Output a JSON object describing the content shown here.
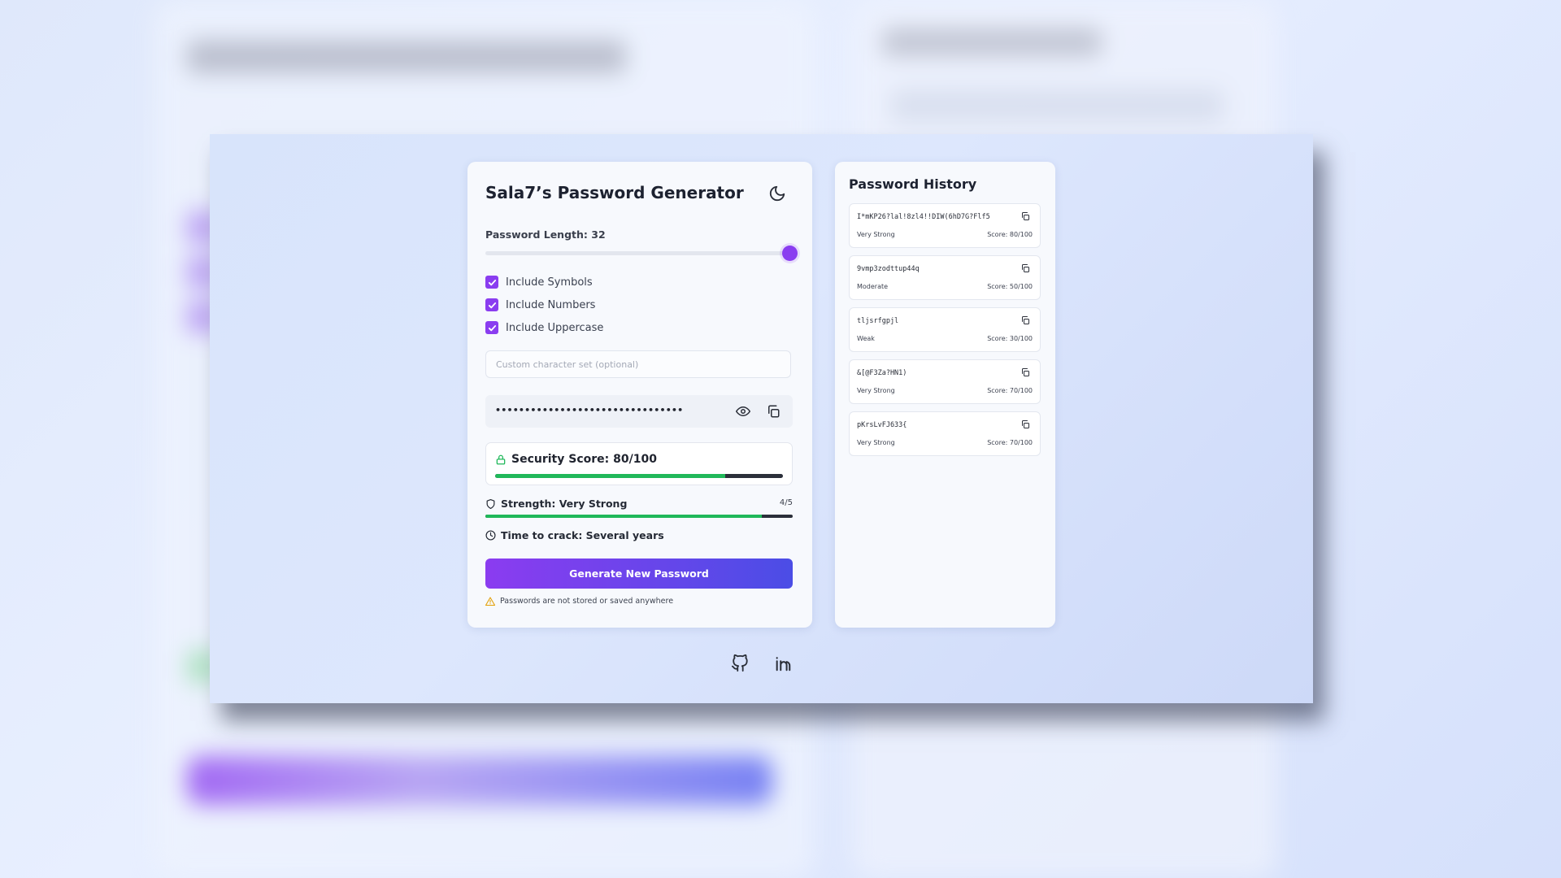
{
  "app": {
    "title": "Sala7’s Password Generator",
    "theme_toggle_icon": "moon-icon"
  },
  "generator": {
    "length_label": "Password Length: 32",
    "length_value": 32,
    "length_max": 32,
    "options": [
      {
        "label": "Include Symbols",
        "checked": true
      },
      {
        "label": "Include Numbers",
        "checked": true
      },
      {
        "label": "Include Uppercase",
        "checked": true
      }
    ],
    "custom_placeholder": "Custom character set (optional)",
    "custom_value": "",
    "password_masked": "••••••••••••••••••••••••••••••••",
    "security_score_label": "Security Score: 80/100",
    "security_score": 80,
    "strength_label": "Strength: Very Strong",
    "strength_ratio": "4/5",
    "strength_level": 0.9,
    "crack_label": "Time to crack: Several years",
    "generate_label": "Generate New Password",
    "note": "Passwords are not stored or saved anywhere",
    "colors": {
      "accent": "#8a3df0",
      "accent_end": "#4b4de6",
      "good": "#20b85a",
      "warn": "#e3a008"
    }
  },
  "history": {
    "title": "Password History",
    "items": [
      {
        "password": "I*mKP26?lal!8zl4!!DIW(6hD7G?Flf5",
        "strength": "Very Strong",
        "score": "Score: 80/100"
      },
      {
        "password": "9vmp3zodttup44q",
        "strength": "Moderate",
        "score": "Score: 50/100"
      },
      {
        "password": "tljsrfgpjl",
        "strength": "Weak",
        "score": "Score: 30/100"
      },
      {
        "password": "&[@F3Za?HN1)",
        "strength": "Very Strong",
        "score": "Score: 70/100"
      },
      {
        "password": "pKrsLvFJ633{",
        "strength": "Very Strong",
        "score": "Score: 70/100"
      }
    ]
  },
  "footer": {
    "links": [
      {
        "icon": "github-icon"
      },
      {
        "icon": "linkedin-icon"
      }
    ]
  }
}
